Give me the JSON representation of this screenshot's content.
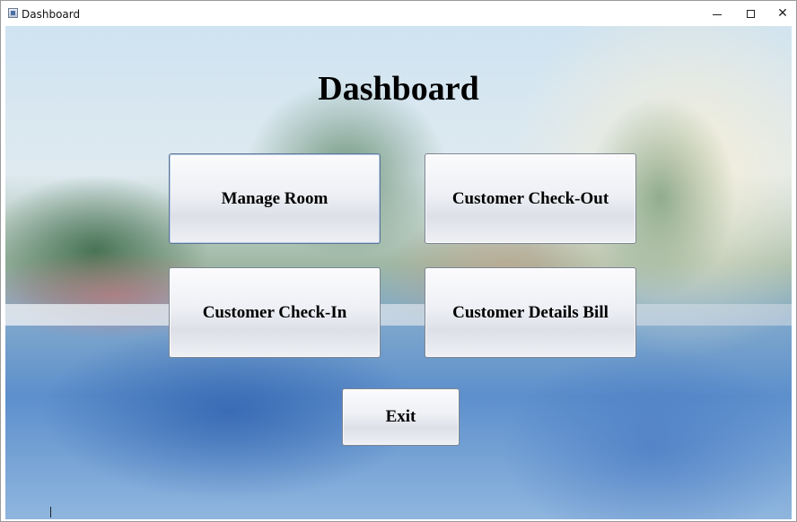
{
  "window": {
    "title": "Dashboard",
    "controls": {
      "minimize_icon": "minimize-icon",
      "maximize_icon": "maximize-icon",
      "close_icon": "close-icon",
      "close_glyph": "✕"
    }
  },
  "main": {
    "heading": "Dashboard",
    "buttons": {
      "manage_room": "Manage Room",
      "checkout": "Customer Check-Out",
      "checkin": "Customer Check-In",
      "details_bill": "Customer Details Bill",
      "exit": "Exit"
    }
  },
  "colors": {
    "button_border": "#7d8590",
    "title_text": "#000000"
  }
}
